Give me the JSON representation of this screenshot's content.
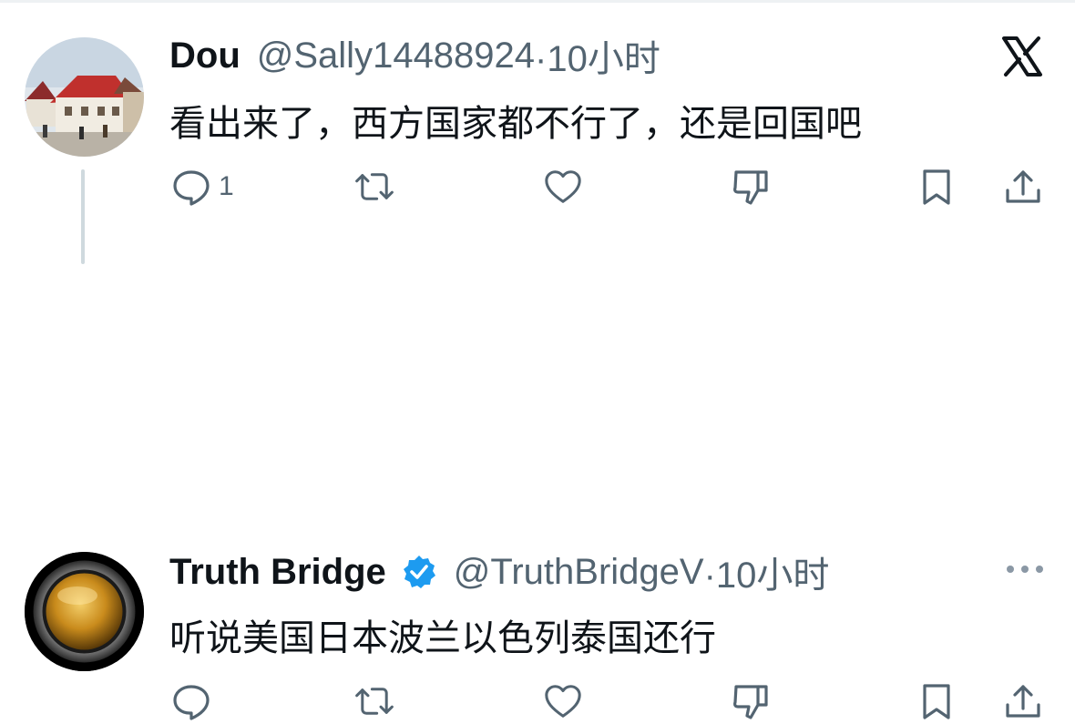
{
  "tweets": [
    {
      "name": "Dou",
      "handle": "@Sally14488924",
      "time": "·10小时",
      "text": "看出来了，西方国家都不行了，还是回国吧",
      "reply_count": "1",
      "avatar": "house-photo-avatar",
      "corner_icon": "x-logo-icon"
    },
    {
      "name": "Truth Bridge",
      "handle": "@TruthBridgeV",
      "time": "·10小时",
      "text": "听说美国日本波兰以色列泰国还行",
      "reply_count": "",
      "verified": true,
      "avatar": "gold-button-avatar",
      "corner_icon": "more-icon"
    }
  ],
  "colors": {
    "text": "#0f1419",
    "secondary": "#536471",
    "verified_blue": "#1d9bf0",
    "thread_line": "#cfd9de"
  }
}
